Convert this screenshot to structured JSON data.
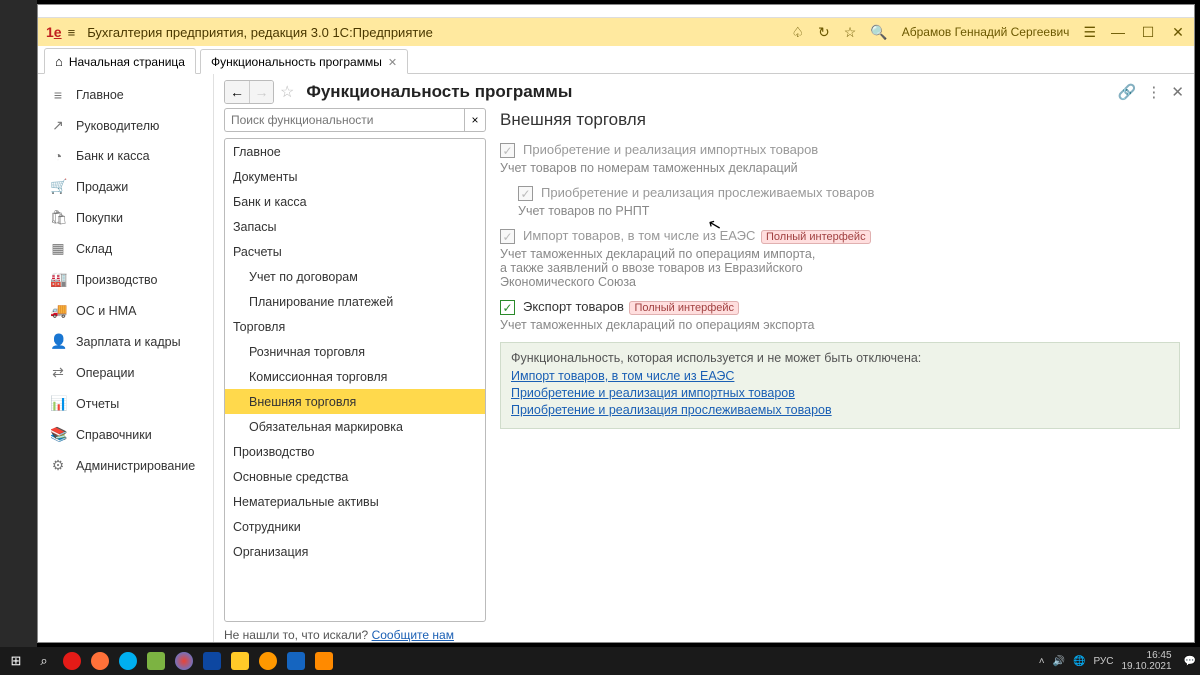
{
  "window": {
    "title_icon": "1C"
  },
  "header": {
    "logo": "1C",
    "title": "Бухгалтерия предприятия, редакция 3.0 1С:Предприятие",
    "user": "Абрамов Геннадий Сергеевич"
  },
  "tabs": [
    {
      "label": "Начальная страница",
      "icon": "home"
    },
    {
      "label": "Функциональность программы",
      "closable": true
    }
  ],
  "sidebar_items": [
    {
      "label": "Главное",
      "icon": "≡"
    },
    {
      "label": "Руководителю",
      "icon": "↗"
    },
    {
      "label": "Банк и касса",
      "icon": "◔"
    },
    {
      "label": "Продажи",
      "icon": "🛒"
    },
    {
      "label": "Покупки",
      "icon": "🛍"
    },
    {
      "label": "Склад",
      "icon": "▦"
    },
    {
      "label": "Производство",
      "icon": "🏭"
    },
    {
      "label": "ОС и НМА",
      "icon": "🚚"
    },
    {
      "label": "Зарплата и кадры",
      "icon": "👤"
    },
    {
      "label": "Операции",
      "icon": "⇄"
    },
    {
      "label": "Отчеты",
      "icon": "📊"
    },
    {
      "label": "Справочники",
      "icon": "📚"
    },
    {
      "label": "Администрирование",
      "icon": "⚙"
    }
  ],
  "page": {
    "title": "Функциональность программы",
    "search_placeholder": "Поиск функциональности"
  },
  "tree": [
    {
      "label": "Главное"
    },
    {
      "label": "Документы"
    },
    {
      "label": "Банк и касса"
    },
    {
      "label": "Запасы"
    },
    {
      "label": "Расчеты"
    },
    {
      "label": "Учет по договорам",
      "sub": true
    },
    {
      "label": "Планирование платежей",
      "sub": true
    },
    {
      "label": "Торговля"
    },
    {
      "label": "Розничная торговля",
      "sub": true
    },
    {
      "label": "Комиссионная торговля",
      "sub": true
    },
    {
      "label": "Внешняя торговля",
      "sub": true,
      "selected": true
    },
    {
      "label": "Обязательная маркировка",
      "sub": true
    },
    {
      "label": "Производство"
    },
    {
      "label": "Основные средства"
    },
    {
      "label": "Нематериальные активы"
    },
    {
      "label": "Сотрудники"
    },
    {
      "label": "Организация"
    }
  ],
  "not_found": {
    "text": "Не нашли то, что искали?  ",
    "link": "Сообщите нам"
  },
  "section": {
    "title": "Внешняя торговля",
    "opt1": {
      "label": "Приобретение и реализация импортных товаров",
      "desc": "Учет товаров по номерам таможенных деклараций"
    },
    "opt2": {
      "label": "Приобретение и реализация прослеживаемых товаров",
      "desc": "Учет товаров по РНПТ"
    },
    "opt3": {
      "label": "Импорт товаров, в том числе из ЕАЭС",
      "badge": "Полный интерфейс",
      "desc": "Учет таможенных деклараций по операциям импорта, а также заявлений о ввозе товаров из Евразийского Экономического Союза"
    },
    "opt4": {
      "label": "Экспорт товаров",
      "badge": "Полный интерфейс",
      "desc": "Учет таможенных деклараций по операциям экспорта"
    },
    "info": {
      "head": "Функциональность, которая используется и не может быть отключена:",
      "links": [
        "Импорт товаров, в том числе из ЕАЭС",
        "Приобретение и реализация импортных товаров",
        "Приобретение и реализация прослеживаемых товаров"
      ]
    }
  },
  "taskbar": {
    "time": "16:45",
    "date": "19.10.2021",
    "lang": "РУС"
  }
}
